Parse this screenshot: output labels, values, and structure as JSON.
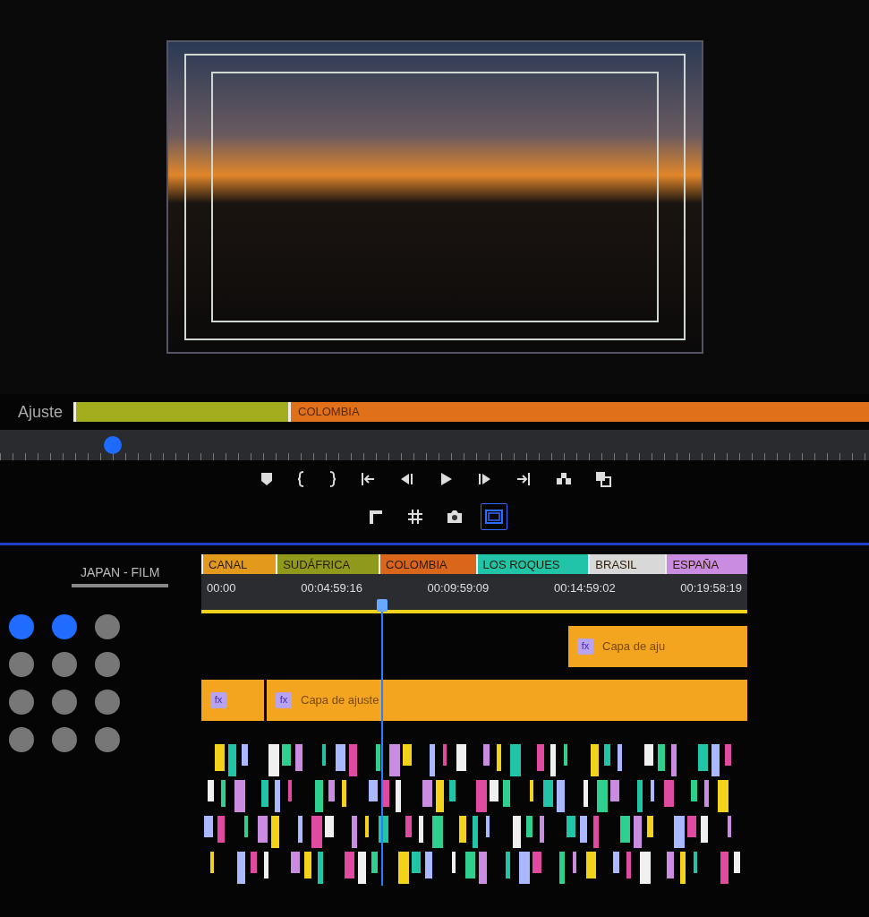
{
  "program_monitor": {
    "video_frame": {
      "safe_margins": true
    },
    "label": "Ajuste",
    "markers": [
      {
        "color": "#a3ad1e"
      },
      {
        "label": "COLOMBIA",
        "color": "#e0701a"
      }
    ],
    "playhead": {
      "level": 0.13
    }
  },
  "transport": {
    "rows": [
      [
        {
          "kind": "marker",
          "selected": false
        },
        {
          "kind": "mark-in",
          "selected": false
        },
        {
          "kind": "mark-out",
          "selected": false
        },
        {
          "kind": "go-to-in",
          "selected": false
        },
        {
          "kind": "step-back",
          "selected": false
        },
        {
          "kind": "play",
          "selected": false
        },
        {
          "kind": "step-forward",
          "selected": false
        },
        {
          "kind": "go-to-out",
          "selected": false
        },
        {
          "kind": "insert",
          "selected": false
        },
        {
          "kind": "overwrite",
          "selected": false
        }
      ],
      [
        {
          "kind": "corner",
          "selected": false
        },
        {
          "kind": "grid",
          "selected": false
        },
        {
          "kind": "camera",
          "selected": false
        },
        {
          "kind": "safe-margins",
          "selected": true
        }
      ]
    ]
  },
  "sequence": {
    "tab": "JAPAN - FILM",
    "header_buttons": [
      {
        "on": true
      },
      {
        "on": true
      },
      {
        "on": false
      },
      {
        "on": false
      },
      {
        "on": false
      },
      {
        "on": false
      },
      {
        "on": false
      },
      {
        "on": false
      },
      {
        "on": false
      },
      {
        "on": false
      },
      {
        "on": false
      },
      {
        "on": false
      }
    ],
    "markers": [
      {
        "label": "CANAL",
        "color": "#e39a1c"
      },
      {
        "label": "SUDÁFRICA",
        "color": "#8f9a1c"
      },
      {
        "label": "COLOMBIA",
        "color": "#d9661a"
      },
      {
        "label": "LOS ROQUES",
        "color": "#22c4a8"
      },
      {
        "label": "BRASIL",
        "color": "#d8d8d8"
      },
      {
        "label": "ESPAÑA",
        "color": "#c98ce0"
      }
    ],
    "timecodes": [
      "00:00",
      "00:04:59:16",
      "00:09:59:09",
      "00:14:59:02",
      "00:19:58:19"
    ],
    "playhead": {
      "level": 0.33
    },
    "tracks": [
      {
        "clips": [
          {
            "kind": "gap"
          },
          {
            "kind": "adjustment",
            "fx": "fx",
            "label": "Capa de aju"
          }
        ]
      },
      {
        "clips": [
          {
            "kind": "adjustment",
            "fx": "fx"
          },
          {
            "kind": "adjustment",
            "fx": "fx",
            "label": "Capa de ajuste"
          }
        ]
      }
    ]
  }
}
